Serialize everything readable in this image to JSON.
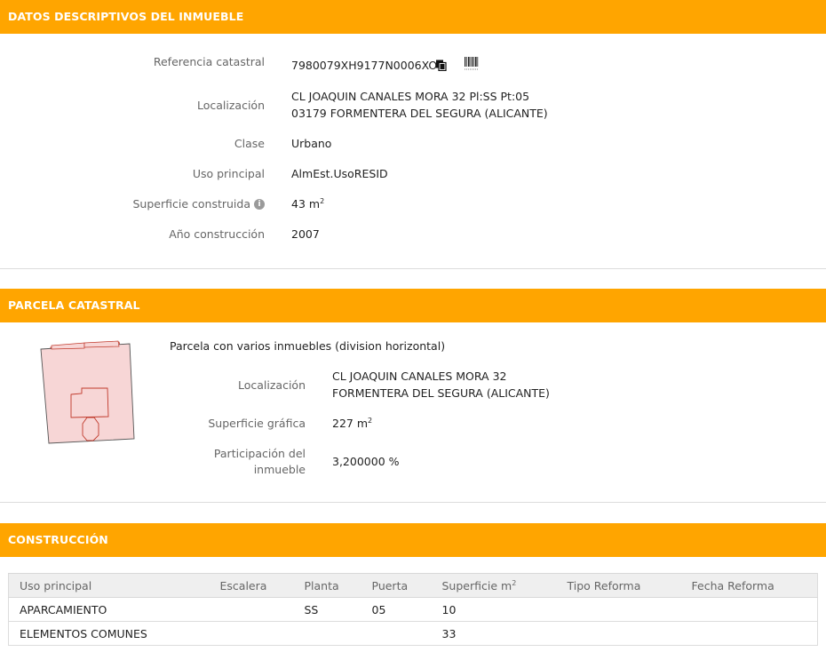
{
  "datos": {
    "header": "DATOS DESCRIPTIVOS DEL INMUEBLE",
    "ref_label": "Referencia catastral",
    "ref_value": "7980079XH9177N0006XO",
    "loc_label": "Localización",
    "loc_line1": "CL JOAQUIN CANALES MORA 32 Pl:SS Pt:05",
    "loc_line2": "03179 FORMENTERA DEL SEGURA (ALICANTE)",
    "clase_label": "Clase",
    "clase_value": "Urbano",
    "uso_label": "Uso principal",
    "uso_value": "AlmEst.UsoRESID",
    "sup_label": "Superficie construida",
    "info_glyph": "i",
    "sup_value": "43 m",
    "sup_unit_exp": "2",
    "anio_label": "Año construcción",
    "anio_value": "2007"
  },
  "parcela": {
    "header": "PARCELA CATASTRAL",
    "note": "Parcela con varios inmuebles (division horizontal)",
    "loc_label": "Localización",
    "loc_line1": "CL JOAQUIN CANALES MORA 32",
    "loc_line2": "FORMENTERA DEL SEGURA (ALICANTE)",
    "sup_label": "Superficie gráfica",
    "sup_value": "227 m",
    "sup_unit_exp": "2",
    "part_label_line1": "Participación del",
    "part_label_line2": "inmueble",
    "part_value": "3,200000 %"
  },
  "construccion": {
    "header": "CONSTRUCCIÓN",
    "columns": [
      "Uso principal",
      "Escalera",
      "Planta",
      "Puerta",
      "Superficie m",
      "Tipo Reforma",
      "Fecha Reforma"
    ],
    "sup_col_exp": "2",
    "rows": [
      [
        "APARCAMIENTO",
        "",
        "SS",
        "05",
        "10",
        "",
        ""
      ],
      [
        "ELEMENTOS COMUNES",
        "",
        "",
        "",
        "33",
        "",
        ""
      ]
    ]
  },
  "icons": {
    "copy": "copy-icon",
    "barcode": "barcode-icon",
    "info": "info-icon",
    "parcel_map": "parcel-map-image"
  },
  "colors": {
    "header_bg": "#FFA500",
    "header_text": "#ffffff",
    "parcel_fill": "#f7d6d6",
    "parcel_stroke": "#c0392b"
  }
}
